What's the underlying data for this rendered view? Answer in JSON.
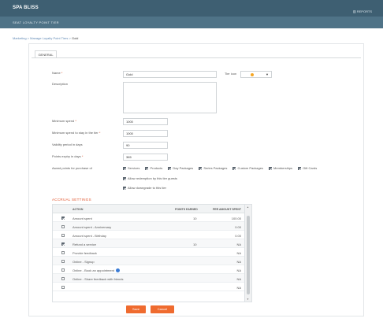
{
  "app": {
    "title": "SPA BLISS",
    "reports_label": "REPORTS",
    "module_title": "SEAT LOYALTY POINT TIER"
  },
  "breadcrumb": {
    "parent": "Marketing > Manage Loyalty Point Tiers >",
    "current": "Gold"
  },
  "tabs": [
    {
      "label": "GENERAL"
    }
  ],
  "form": {
    "name_label": "Name",
    "name_value": "Gold",
    "tier_icon_label": "Tier icon",
    "description_label": "Description",
    "description_value": "",
    "min_spend_label": "Minimum spend",
    "min_spend_value": "1000",
    "min_spend_stay_label": "Minimum spend to stay in the tier",
    "min_spend_stay_value": "1000",
    "validity_label": "Validity period in days",
    "validity_value": "90",
    "points_expiry_label": "Points expiry in days",
    "points_expiry_value": "365",
    "award_label": "Award points for purchase of",
    "award_items": [
      {
        "label": "Services",
        "checked": true
      },
      {
        "label": "Products",
        "checked": true
      },
      {
        "label": "Day Packages",
        "checked": true
      },
      {
        "label": "Series Packages",
        "checked": true
      },
      {
        "label": "Custom Packages",
        "checked": true
      },
      {
        "label": "Memberships",
        "checked": true
      },
      {
        "label": "Gift Cards",
        "checked": true
      }
    ],
    "allow_redemption_label": "Allow redemption by this tier guests",
    "allow_upgrade_label": "Allow downgrade to this tier"
  },
  "accrual": {
    "title": "ACCRUAL SETTINGS",
    "headers": {
      "action": "ACTION",
      "points": "POINTS EARNED",
      "per_amount": "PER AMOUNT SPENT"
    },
    "rows": [
      {
        "checked": true,
        "action": "Amount spent",
        "points": "10",
        "per_amount": "100.00"
      },
      {
        "checked": false,
        "action": "Amount spent - Anniversary",
        "points": "",
        "per_amount": "0.00"
      },
      {
        "checked": false,
        "action": "Amount spent - Birthday",
        "points": "",
        "per_amount": "0.00"
      },
      {
        "checked": true,
        "action": "Refund a service",
        "points": "10",
        "per_amount": "NA"
      },
      {
        "checked": false,
        "action": "Provide feedback",
        "points": "",
        "per_amount": "NA"
      },
      {
        "checked": false,
        "action": "Online - Signup",
        "points": "",
        "per_amount": "NA"
      },
      {
        "checked": false,
        "action": "Online - Book an appointment",
        "points": "",
        "per_amount": "NA",
        "info": true
      },
      {
        "checked": false,
        "action": "Online - Share feedback with friends",
        "points": "",
        "per_amount": "NA"
      },
      {
        "checked": false,
        "action": "",
        "points": "",
        "per_amount": "NA"
      }
    ]
  },
  "buttons": {
    "save": "Save",
    "cancel": "Cancel"
  },
  "colors": {
    "topbar": "#3e5f72",
    "accent": "#ef6b2f",
    "tier_icon": "#f5a623"
  }
}
